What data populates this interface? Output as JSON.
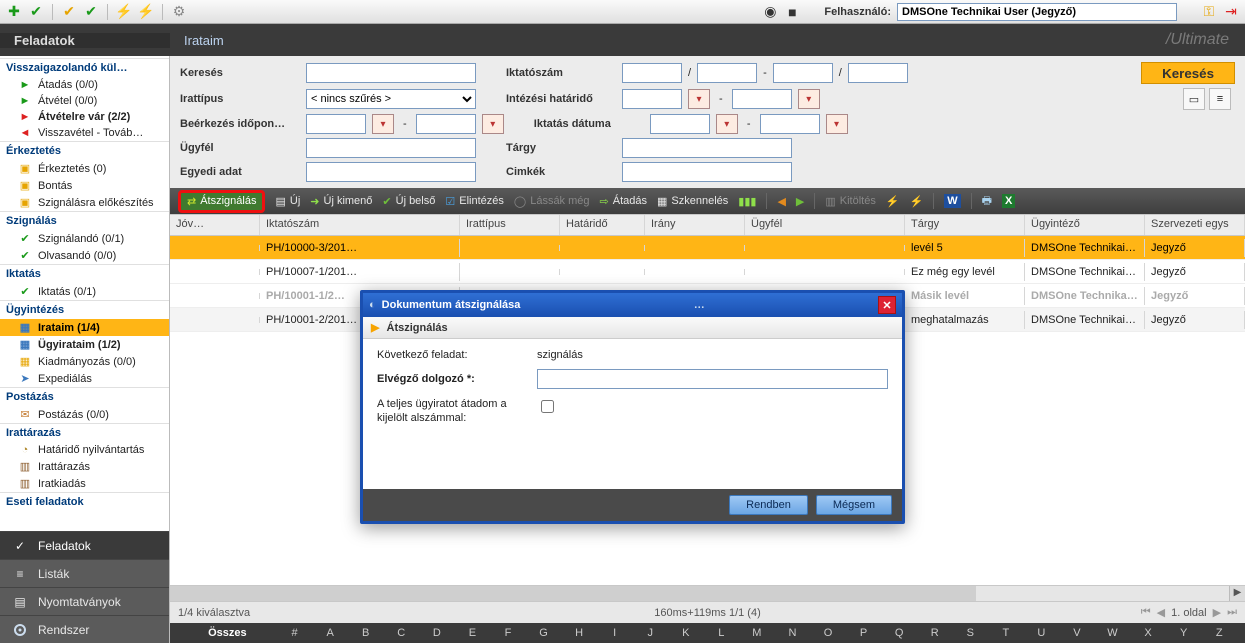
{
  "topbar": {
    "user_label": "Felhasználó:",
    "user_value": "DMSOne Technikai User (Jegyző)"
  },
  "header": {
    "side_title": "Feladatok",
    "content_title": "Irataim",
    "brand": "/Ultimate"
  },
  "sidebar": {
    "groups": [
      {
        "title": "Visszaigazolandó kül…",
        "key": "vissza",
        "items": [
          {
            "label": "Átadás (0/0)",
            "icon": "►",
            "color": "#1a9a1a"
          },
          {
            "label": "Átvétel (0/0)",
            "icon": "►",
            "color": "#1a9a1a"
          },
          {
            "label": "Átvételre vár (2/2)",
            "icon": "►",
            "color": "#d22",
            "bold": true
          },
          {
            "label": "Visszavétel - Továb…",
            "icon": "◄",
            "color": "#d22"
          }
        ]
      },
      {
        "title": "Érkeztetés",
        "key": "erk",
        "items": [
          {
            "label": "Érkeztetés (0)",
            "icon": "▣",
            "color": "#e6a400"
          },
          {
            "label": "Bontás",
            "icon": "▣",
            "color": "#e6a400"
          },
          {
            "label": "Szignálásra előkészítés",
            "icon": "▣",
            "color": "#e6a400"
          }
        ]
      },
      {
        "title": "Szignálás",
        "key": "szig",
        "items": [
          {
            "label": "Szignálandó (0/1)",
            "icon": "✔",
            "color": "#1a9a1a"
          },
          {
            "label": "Olvasandó (0/0)",
            "icon": "✔",
            "color": "#1a9a1a"
          }
        ]
      },
      {
        "title": "Iktatás",
        "key": "ikt",
        "items": [
          {
            "label": "Iktatás (0/1)",
            "icon": "✔",
            "color": "#1a9a1a"
          }
        ]
      },
      {
        "title": "Ügyintézés",
        "key": "ugyi",
        "items": [
          {
            "label": "Irataim (1/4)",
            "icon": "▦",
            "color": "#3b78bd",
            "active": true,
            "bold": true
          },
          {
            "label": "Ügyirataim (1/2)",
            "icon": "▦",
            "color": "#3b78bd",
            "bold": true
          },
          {
            "label": "Kiadmányozás (0/0)",
            "icon": "▦",
            "color": "#e6a400"
          },
          {
            "label": "Expediálás",
            "icon": "➤",
            "color": "#3b78bd"
          }
        ]
      },
      {
        "title": "Postázás",
        "key": "post",
        "items": [
          {
            "label": "Postázás (0/0)",
            "icon": "✉",
            "color": "#c47a2f"
          }
        ]
      },
      {
        "title": "Irattárazás",
        "key": "irat",
        "items": [
          {
            "label": "Határidő nyilvántartás",
            "icon": "◔",
            "color": "#b08a2f"
          },
          {
            "label": "Irattárazás",
            "icon": "▥",
            "color": "#8a5a2a"
          },
          {
            "label": "Iratkiadás",
            "icon": "▥",
            "color": "#8a5a2a"
          }
        ]
      },
      {
        "title": "Eseti feladatok",
        "key": "eseti",
        "items": []
      }
    ],
    "nav": [
      {
        "label": "Feladatok",
        "icon": "check",
        "active": true
      },
      {
        "label": "Listák",
        "icon": "list"
      },
      {
        "label": "Nyomtatványok",
        "icon": "doc"
      },
      {
        "label": "Rendszer",
        "icon": "gear"
      }
    ]
  },
  "filters": {
    "kereses_label": "Keresés",
    "irattipus_label": "Irattípus",
    "irattipus_value": "< nincs szűrés >",
    "beerk_label": "Beérkezés időpon…",
    "ugyfel_label": "Ügyfél",
    "egyedi_label": "Egyedi adat",
    "iktatoszam_label": "Iktatószám",
    "hatarido_label": "Intézési határidő",
    "iktatas_datuma_label": "Iktatás dátuma",
    "targy_label": "Tárgy",
    "cimkek_label": "Cimkék",
    "search_btn": "Keresés"
  },
  "actionbar": {
    "atszignalas": "Átszignálás",
    "uj": "Új",
    "uj_kimeno": "Új kimenő",
    "uj_belso": "Új belső",
    "elintezes": "Elintézés",
    "lassak_meg": "Lássák még",
    "atadas": "Átadás",
    "szkenneles": "Szkennelés",
    "kitoltes": "Kitöltés"
  },
  "grid": {
    "columns": {
      "jov": "Jóv…",
      "ikt": "Iktatószám",
      "it": "Irattípus",
      "hat": "Határidő",
      "ir": "Irány",
      "ugyf": "Ügyfél",
      "targy": "Tárgy",
      "ugyi": "Ügyintéző",
      "szerv": "Szervezeti egys"
    },
    "rows": [
      {
        "ikt": "PH/10000-3/201…",
        "targy": "levél 5",
        "ugyi": "DMSOne Technikai U…",
        "szerv": "Jegyző",
        "sel": true
      },
      {
        "ikt": "PH/10007-1/201…",
        "targy": "Ez még egy levél",
        "ugyi": "DMSOne Technikai U…",
        "szerv": "Jegyző"
      },
      {
        "ikt": "PH/10001-1/2…",
        "targy": "Másik levél",
        "ugyi": "DMSOne Technika…",
        "szerv": "Jegyző",
        "dim": true,
        "bold": true
      },
      {
        "ikt": "PH/10001-2/201…",
        "targy": "meghatalmazás",
        "ugyi": "DMSOne Technikai U…",
        "szerv": "Jegyző",
        "alt": true
      }
    ],
    "footer_sel": "1/4 kiválasztva",
    "footer_mid": "160ms+119ms 1/1 (4)",
    "footer_page": "1. oldal"
  },
  "alpha": {
    "first": "Összes",
    "letters": [
      "#",
      "A",
      "B",
      "C",
      "D",
      "E",
      "F",
      "G",
      "H",
      "I",
      "J",
      "K",
      "L",
      "M",
      "N",
      "O",
      "P",
      "Q",
      "R",
      "S",
      "T",
      "U",
      "V",
      "W",
      "X",
      "Y",
      "Z"
    ]
  },
  "modal": {
    "title": "Dokumentum átszignálása",
    "subtitle": "Átszignálás",
    "row1_label": "Következő feladat:",
    "row1_value": "szignálás",
    "row2_label": "Elvégző dolgozó *:",
    "row3_label": "A teljes ügyiratot átadom a kijelölt alszámmal:",
    "ok": "Rendben",
    "cancel": "Mégsem"
  }
}
